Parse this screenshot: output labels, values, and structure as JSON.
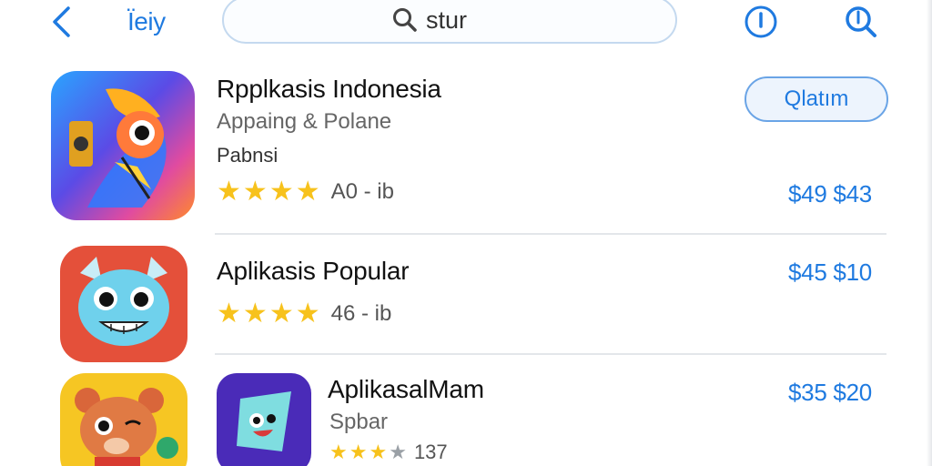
{
  "nav": {
    "back_icon": "chevron-left-icon",
    "title": "Ïeiy",
    "search_value": "stur",
    "info_icon": "info-icon",
    "search_icon": "search-icon"
  },
  "accent_color": "#1f7ae0",
  "star_color": "#f7c21c",
  "apps": [
    {
      "name": "Rpplkasis Indonesia",
      "subtitle": "Appaing & Polane",
      "category": "Pabnsi",
      "stars": 4,
      "rating_text": "A0 - ib",
      "action_label": "Qlatım",
      "price": "$49 $43"
    },
    {
      "name": "Aplikasis Popular",
      "stars": 4,
      "rating_text": "46 - ib",
      "price": "$45 $10"
    },
    {
      "name": "AplikasalMam",
      "subtitle": "Spbar",
      "stars": 3.5,
      "rating_text": "137",
      "price": "$35 $20"
    }
  ]
}
